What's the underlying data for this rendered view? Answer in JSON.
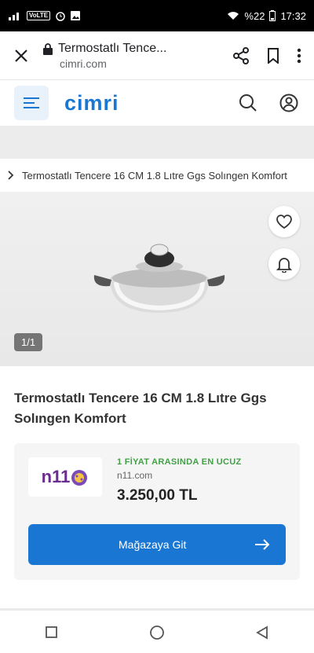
{
  "status": {
    "signal_label": "VoLTE",
    "battery": "%22",
    "time": "17:32"
  },
  "browser": {
    "title": "Termostatlı Tence...",
    "url": "cimri.com"
  },
  "site": {
    "logo_text": "cimri"
  },
  "breadcrumb": {
    "text": "Termostatlı Tencere 16 CM 1.8 Lıtre Ggs Solıngen Komfort"
  },
  "gallery": {
    "counter": "1/1"
  },
  "product": {
    "title": "Termostatlı Tencere 16 CM 1.8 Lıtre Ggs Solıngen Komfort"
  },
  "offer": {
    "shop_logo_text": "n11",
    "badge": "1 FİYAT ARASINDA EN UCUZ",
    "shop": "n11.com",
    "price": "3.250,00 TL",
    "button": "Mağazaya Git"
  },
  "colors": {
    "brand": "#1976d2",
    "badge": "#43a047"
  },
  "icons": [
    "wifi-icon",
    "alarm-icon",
    "image-icon",
    "close-icon",
    "lock-icon",
    "share-icon",
    "bookmark-icon",
    "more-icon",
    "menu-icon",
    "search-icon",
    "user-icon",
    "chevron-right-icon",
    "heart-icon",
    "bell-icon",
    "arrow-right-icon",
    "nav-square-icon",
    "nav-circle-icon",
    "nav-back-icon"
  ]
}
